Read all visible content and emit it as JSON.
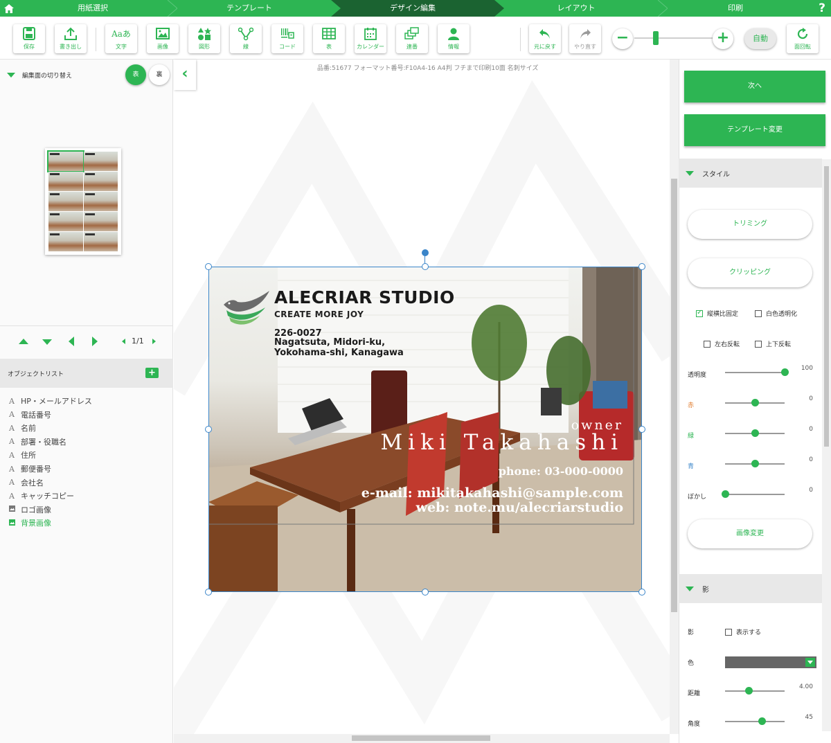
{
  "steps": [
    {
      "label": "用紙選択",
      "active": false
    },
    {
      "label": "テンプレート",
      "active": false
    },
    {
      "label": "デザイン編集",
      "active": true
    },
    {
      "label": "レイアウト",
      "active": false
    },
    {
      "label": "印刷",
      "active": false
    }
  ],
  "help_label": "?",
  "toolbar": {
    "save": "保存",
    "export": "書き出し",
    "text": "文字",
    "text_glyph": "Aaあ",
    "image": "画像",
    "shape": "図形",
    "line": "線",
    "code": "コード",
    "table": "表",
    "calendar": "カレンダー",
    "serial": "連番",
    "info": "情報",
    "undo": "元に戻す",
    "redo": "やり直す",
    "zoom_out": "−",
    "zoom_in": "+",
    "zoom_auto": "自動",
    "rotate": "面回転"
  },
  "left": {
    "switch_label": "編集面の切り替え",
    "front": "表",
    "back": "裏",
    "page_indicator": "1/1",
    "object_list_label": "オブジェクトリスト",
    "objects": [
      {
        "name": "HP・メールアドレス",
        "type": "text",
        "active": false
      },
      {
        "name": "電話番号",
        "type": "text",
        "active": false
      },
      {
        "name": "名前",
        "type": "text",
        "active": false
      },
      {
        "name": "部署・役職名",
        "type": "text",
        "active": false
      },
      {
        "name": "住所",
        "type": "text",
        "active": false
      },
      {
        "name": "郵便番号",
        "type": "text",
        "active": false
      },
      {
        "name": "会社名",
        "type": "text",
        "active": false
      },
      {
        "name": "キャッチコピー",
        "type": "text",
        "active": false
      },
      {
        "name": "ロゴ画像",
        "type": "image",
        "active": false
      },
      {
        "name": "背景画像",
        "type": "image",
        "active": true
      }
    ]
  },
  "canvas": {
    "info": "品番:51677 フォーマット番号:F10A4-16 A4判 フチまで印刷10面 名刺サイズ"
  },
  "card": {
    "company": "ALECRIAR STUDIO",
    "tagline": "CREATE MORE JOY",
    "postal": "226-0027",
    "address1": "Nagatsuta, Midori-ku,",
    "address2": "Yokohama-shi, Kanagawa",
    "title": "owner",
    "name": "Miki Takahashi",
    "phone": "phone: 03-000-0000",
    "email": "e-mail: mikitakahashi@sample.com",
    "web": "web: note.mu/alecriarstudio"
  },
  "right": {
    "next": "次へ",
    "change_template": "テンプレート変更",
    "style_section": "スタイル",
    "trimming": "トリミング",
    "clipping": "クリッピング",
    "keep_ratio": "縦横比固定",
    "keep_ratio_checked": true,
    "white_transparent": "白色透明化",
    "white_transparent_checked": false,
    "flip_h": "左右反転",
    "flip_h_checked": false,
    "flip_v": "上下反転",
    "flip_v_checked": false,
    "sliders": [
      {
        "label": "透明度",
        "value": "100",
        "level": 1.0,
        "color": "#333333"
      },
      {
        "label": "赤",
        "value": "0",
        "level": 0.5,
        "color": "#e07a2b"
      },
      {
        "label": "緑",
        "value": "0",
        "level": 0.5,
        "color": "#2db553"
      },
      {
        "label": "青",
        "value": "0",
        "level": 0.5,
        "color": "#3a85c9"
      },
      {
        "label": "ぼかし",
        "value": "0",
        "level": 0.0,
        "color": "#333333"
      }
    ],
    "change_image": "画像変更",
    "shadow_section": "影",
    "shadow_label": "影",
    "shadow_show": "表示する",
    "shadow_show_checked": false,
    "color_label": "色",
    "distance_label": "距離",
    "distance_value": "4.00",
    "distance_level": 0.4,
    "angle_label": "角度",
    "angle_value": "45",
    "angle_level": 0.62
  },
  "colors": {
    "accent": "#2db553",
    "accent_dark": "#1b6331",
    "selection": "#3a85c9"
  }
}
